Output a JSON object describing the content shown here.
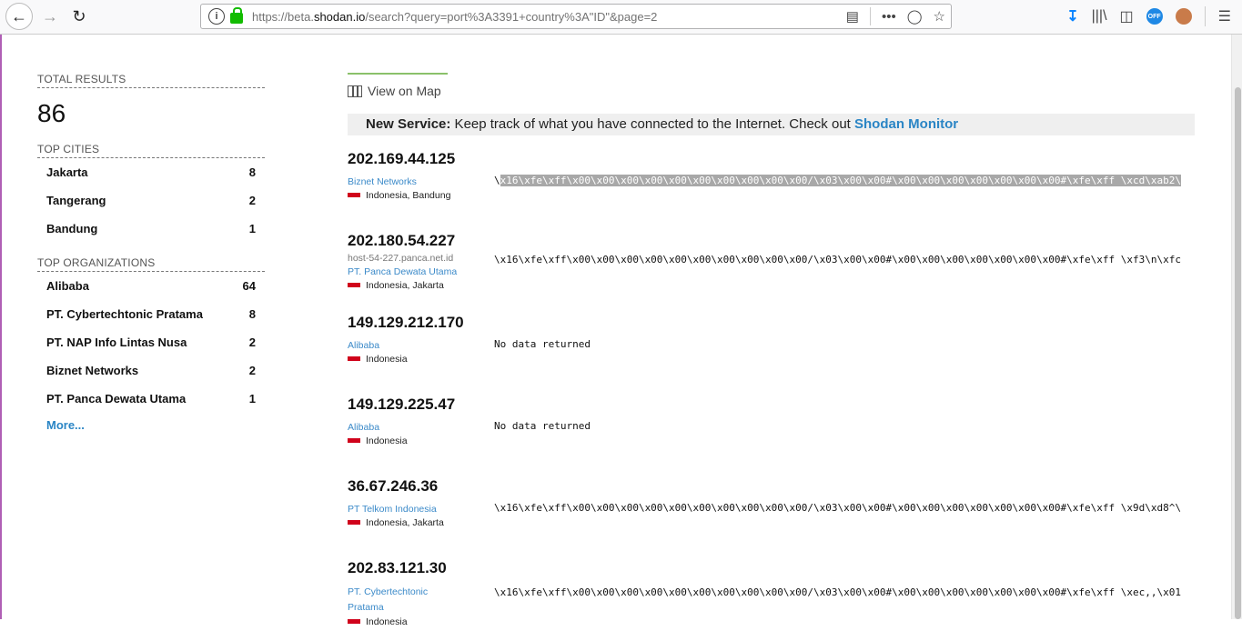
{
  "browser": {
    "url_prefix": "https://beta.",
    "url_domain": "shodan.io",
    "url_rest": "/search?query=port%3A3391+country%3A\"ID\"&page=2"
  },
  "sidebar": {
    "total_label": "TOTAL RESULTS",
    "total_value": "86",
    "cities_label": "TOP CITIES",
    "cities": [
      {
        "name": "Jakarta",
        "count": "8"
      },
      {
        "name": "Tangerang",
        "count": "2"
      },
      {
        "name": "Bandung",
        "count": "1"
      }
    ],
    "orgs_label": "TOP ORGANIZATIONS",
    "orgs": [
      {
        "name": "Alibaba",
        "count": "64"
      },
      {
        "name": "PT. Cybertechtonic Pratama",
        "count": "8"
      },
      {
        "name": "PT. NAP Info Lintas Nusa",
        "count": "2"
      },
      {
        "name": "Biznet Networks",
        "count": "2"
      },
      {
        "name": "PT. Panca Dewata Utama",
        "count": "1"
      }
    ],
    "more_label": "More..."
  },
  "main": {
    "map_label": "View on Map",
    "notice_bold": "New Service:",
    "notice_text": " Keep track of what you have connected to the Internet. Check out ",
    "notice_link": "Shodan Monitor",
    "results": [
      {
        "ip": "202.169.44.125",
        "host": "",
        "org": "Biznet Networks",
        "location": "Indonesia, Bandung",
        "banner_first": "\\",
        "banner_sel": "x16\\xfe\\xff\\x00\\x00\\x00\\x00\\x00\\x00\\x00\\x00\\x00\\x00/\\x03\\x00\\x00#\\x00\\x00\\x00\\x00\\x00\\x00\\x00#\\xfe\\xff \\xcd\\xab2\\"
      },
      {
        "ip": "202.180.54.227",
        "host": "host-54-227.panca.net.id",
        "org": "PT. Panca Dewata Utama",
        "location": "Indonesia, Jakarta",
        "banner": "\\x16\\xfe\\xff\\x00\\x00\\x00\\x00\\x00\\x00\\x00\\x00\\x00\\x00/\\x03\\x00\\x00#\\x00\\x00\\x00\\x00\\x00\\x00\\x00#\\xfe\\xff \\xf3\\n\\xfc"
      },
      {
        "ip": "149.129.212.170",
        "host": "",
        "org": "Alibaba",
        "location": "Indonesia",
        "banner": "No data returned"
      },
      {
        "ip": "149.129.225.47",
        "host": "",
        "org": "Alibaba",
        "location": "Indonesia",
        "banner": "No data returned"
      },
      {
        "ip": "36.67.246.36",
        "host": "",
        "org": "PT Telkom Indonesia",
        "location": "Indonesia, Jakarta",
        "banner": "\\x16\\xfe\\xff\\x00\\x00\\x00\\x00\\x00\\x00\\x00\\x00\\x00\\x00/\\x03\\x00\\x00#\\x00\\x00\\x00\\x00\\x00\\x00\\x00#\\xfe\\xff \\x9d\\xd8^\\"
      },
      {
        "ip": "202.83.121.30",
        "host": "",
        "org": "PT. Cybertechtonic Pratama",
        "location": "Indonesia",
        "banner": "\\x16\\xfe\\xff\\x00\\x00\\x00\\x00\\x00\\x00\\x00\\x00\\x00\\x00/\\x03\\x00\\x00#\\x00\\x00\\x00\\x00\\x00\\x00\\x00#\\xfe\\xff \\xec,,\\x01"
      }
    ]
  }
}
